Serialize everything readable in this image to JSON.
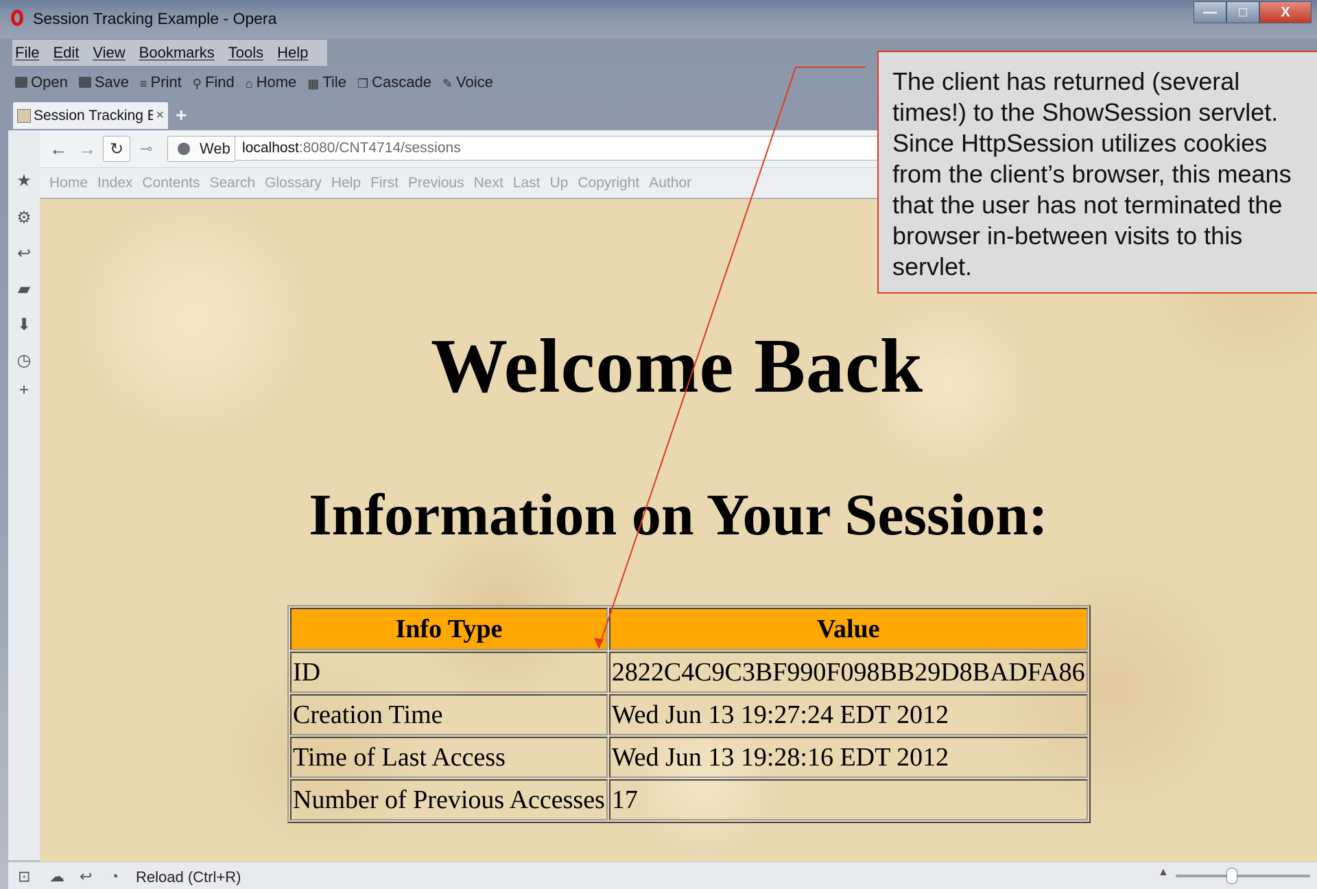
{
  "window": {
    "title": "Session Tracking Example - Opera",
    "buttons": {
      "minimize": "—",
      "maximize": "□",
      "close": "X"
    }
  },
  "menu": [
    "File",
    "Edit",
    "View",
    "Bookmarks",
    "Tools",
    "Help"
  ],
  "toolbar": [
    {
      "label": "Open",
      "icon": "folder-icon"
    },
    {
      "label": "Save",
      "icon": "save-icon"
    },
    {
      "label": "Print",
      "icon": "print-icon"
    },
    {
      "label": "Find",
      "icon": "find-icon"
    },
    {
      "label": "Home",
      "icon": "home-icon"
    },
    {
      "label": "Tile",
      "icon": "tile-icon"
    },
    {
      "label": "Cascade",
      "icon": "cascade-icon"
    },
    {
      "label": "Voice",
      "icon": "voice-icon"
    }
  ],
  "tab": {
    "label": "Session Tracking E...",
    "close": "×",
    "add": "+"
  },
  "addressbar": {
    "scope": "Web",
    "url_host": "localhost",
    "url_rest": ":8080/CNT4714/sessions"
  },
  "navlinks": [
    "Home",
    "Index",
    "Contents",
    "Search",
    "Glossary",
    "Help",
    "First",
    "Previous",
    "Next",
    "Last",
    "Up",
    "Copyright",
    "Author"
  ],
  "page": {
    "heading": "Welcome Back",
    "subheading": "Information on Your Session:",
    "table": {
      "headers": [
        "Info Type",
        "Value"
      ],
      "rows": [
        [
          "ID",
          "2822C4C9C3BF990F098BB29D8BADFA86"
        ],
        [
          "Creation Time",
          "Wed Jun 13 19:27:24 EDT 2012"
        ],
        [
          "Time of Last Access",
          "Wed Jun 13 19:28:16 EDT 2012"
        ],
        [
          "Number of Previous Accesses",
          "17"
        ]
      ]
    }
  },
  "statusbar": {
    "text": "Reload (Ctrl+R)"
  },
  "callout": {
    "text": "The client has returned (several times!) to the ShowSession servlet. Since HttpSession utilizes cookies from the client’s browser, this means that the user has not terminated the browser in-between visits to this servlet."
  },
  "colors": {
    "table_header": "#ffa801",
    "callout_border": "#e33a1c",
    "page_background": "#ead8b1"
  }
}
